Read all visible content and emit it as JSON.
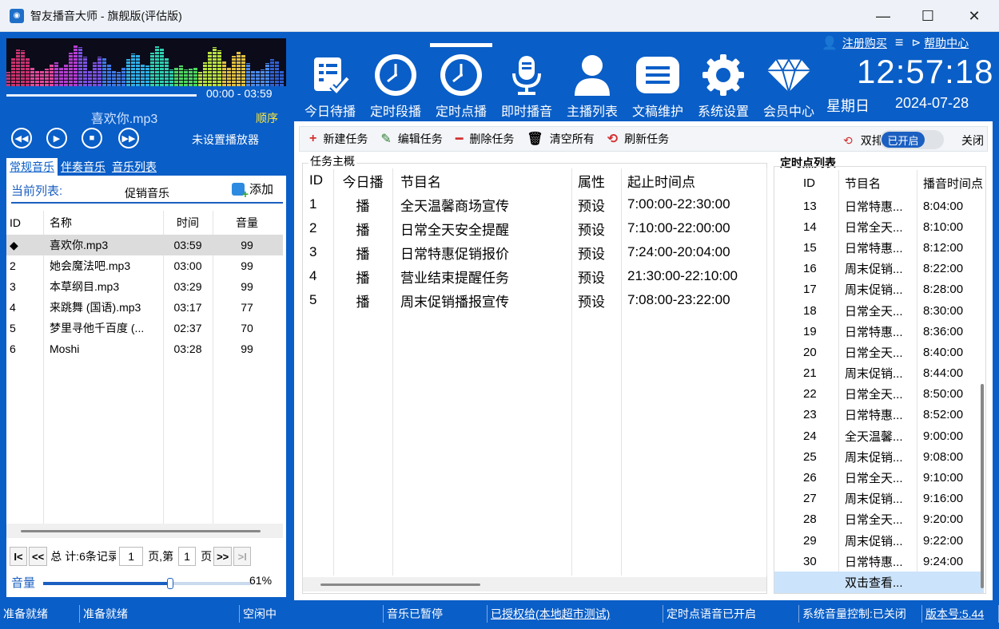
{
  "window": {
    "title": "智友播音大师 - 旗舰版(评估版)",
    "minimize": "—",
    "maximize": "☐",
    "close": "✕"
  },
  "player": {
    "time_display": "00:00 - 03:59",
    "song": "喜欢你.mp3",
    "order_mode": "顺序",
    "no_player": "未设置播放器",
    "buttons": [
      "prev-icon",
      "play-icon",
      "stop-icon",
      "next-icon"
    ]
  },
  "music_tabs": [
    {
      "label": "常规音乐"
    },
    {
      "label": "伴奏音乐"
    },
    {
      "label": "音乐列表"
    }
  ],
  "current_list": {
    "label": "当前列表:",
    "name": "促销音乐",
    "add": "添加"
  },
  "music_table": {
    "headers": {
      "id": "ID",
      "name": "名称",
      "time": "时间",
      "volume": "音量"
    },
    "rows": [
      {
        "id": "◆",
        "name": "喜欢你.mp3",
        "time": "03:59",
        "volume": "99"
      },
      {
        "id": "2",
        "name": "她会魔法吧.mp3",
        "time": "03:00",
        "volume": "99"
      },
      {
        "id": "3",
        "name": "本草纲目.mp3",
        "time": "03:29",
        "volume": "99"
      },
      {
        "id": "4",
        "name": "来跳舞 (国语).mp3",
        "time": "03:17",
        "volume": "77"
      },
      {
        "id": "5",
        "name": "梦里寻他千百度 (...",
        "time": "02:37",
        "volume": "70"
      },
      {
        "id": "6",
        "name": "Moshi",
        "time": "03:28",
        "volume": "99"
      }
    ]
  },
  "pager": {
    "first": "I<",
    "prev": "<<",
    "total": "总",
    "count": "计:6条记录",
    "page_no": "1",
    "page_sep": "页,第",
    "page_of": "1",
    "page_unit": "页",
    "next": ">>",
    "last": ">I"
  },
  "volume": {
    "label": "音量",
    "value": "61%",
    "level": 0.61
  },
  "nav": [
    {
      "label": "今日待播",
      "icon": "clipboard-check-icon"
    },
    {
      "label": "定时段播",
      "icon": "clock-icon"
    },
    {
      "label": "定时点播",
      "icon": "clock-icon",
      "active": true
    },
    {
      "label": "即时播音",
      "icon": "microphone-icon"
    },
    {
      "label": "主播列表",
      "icon": "user-icon"
    },
    {
      "label": "文稿维护",
      "icon": "document-icon"
    },
    {
      "label": "系统设置",
      "icon": "gear-icon"
    },
    {
      "label": "会员中心",
      "icon": "diamond-icon"
    }
  ],
  "header": {
    "register": "注册购买",
    "help": "帮助中心",
    "clock": "12:57:18",
    "weekday": "星期日",
    "date": "2024-07-28"
  },
  "toolbar": {
    "new_task": "新建任务",
    "edit_task": "编辑任务",
    "delete_task": "删除任务",
    "clear_all": "清空所有",
    "refresh": "刷新任务",
    "dual": "双排",
    "enabled": "已开启",
    "disabled": "关闭"
  },
  "task_overview": {
    "title": "任务主概",
    "headers": {
      "id": "ID",
      "today": "今日播",
      "name": "节目名",
      "attr": "属性",
      "range": "起止时间点"
    },
    "rows": [
      {
        "id": "1",
        "today": "播",
        "name": "全天温馨商场宣传",
        "attr": "预设",
        "range": "7:00:00-22:30:00"
      },
      {
        "id": "2",
        "today": "播",
        "name": "日常全天安全提醒",
        "attr": "预设",
        "range": "7:10:00-22:00:00"
      },
      {
        "id": "3",
        "today": "播",
        "name": "日常特惠促销报价",
        "attr": "预设",
        "range": "7:24:00-20:04:00"
      },
      {
        "id": "4",
        "today": "播",
        "name": "营业结束提醒任务",
        "attr": "预设",
        "range": "21:30:00-22:10:00"
      },
      {
        "id": "5",
        "today": "播",
        "name": "周末促销播报宣传",
        "attr": "预设",
        "range": "7:08:00-23:22:00"
      }
    ]
  },
  "timer_list": {
    "title": "定时点列表",
    "headers": {
      "id": "ID",
      "name": "节目名",
      "time": "播音时间点"
    },
    "rows": [
      {
        "id": "13",
        "name": "日常特惠...",
        "time": "8:04:00"
      },
      {
        "id": "14",
        "name": "日常全天...",
        "time": "8:10:00"
      },
      {
        "id": "15",
        "name": "日常特惠...",
        "time": "8:12:00"
      },
      {
        "id": "16",
        "name": "周末促销...",
        "time": "8:22:00"
      },
      {
        "id": "17",
        "name": "周末促销...",
        "time": "8:28:00"
      },
      {
        "id": "18",
        "name": "日常全天...",
        "time": "8:30:00"
      },
      {
        "id": "19",
        "name": "日常特惠...",
        "time": "8:36:00"
      },
      {
        "id": "20",
        "name": "日常全天...",
        "time": "8:40:00"
      },
      {
        "id": "21",
        "name": "周末促销...",
        "time": "8:44:00"
      },
      {
        "id": "22",
        "name": "日常全天...",
        "time": "8:50:00"
      },
      {
        "id": "23",
        "name": "日常特惠...",
        "time": "8:52:00"
      },
      {
        "id": "24",
        "name": "全天温馨...",
        "time": "9:00:00"
      },
      {
        "id": "25",
        "name": "周末促销...",
        "time": "9:08:00"
      },
      {
        "id": "26",
        "name": "日常全天...",
        "time": "9:10:00"
      },
      {
        "id": "27",
        "name": "周末促销...",
        "time": "9:16:00"
      },
      {
        "id": "28",
        "name": "日常全天...",
        "time": "9:20:00"
      },
      {
        "id": "29",
        "name": "周末促销...",
        "time": "9:22:00"
      },
      {
        "id": "30",
        "name": "日常特惠...",
        "time": "9:24:00"
      }
    ],
    "more": "双击查看..."
  },
  "status": [
    {
      "text": "准备就绪"
    },
    {
      "text": "准备就绪"
    },
    {
      "text": "空闲中"
    },
    {
      "text": "音乐已暂停"
    },
    {
      "text": "已授权给(本地超市测试)",
      "link": true
    },
    {
      "text": "定时点语音已开启"
    },
    {
      "text": "系统音量控制:已关闭"
    },
    {
      "text": "版本号:5.44",
      "link": true
    }
  ]
}
